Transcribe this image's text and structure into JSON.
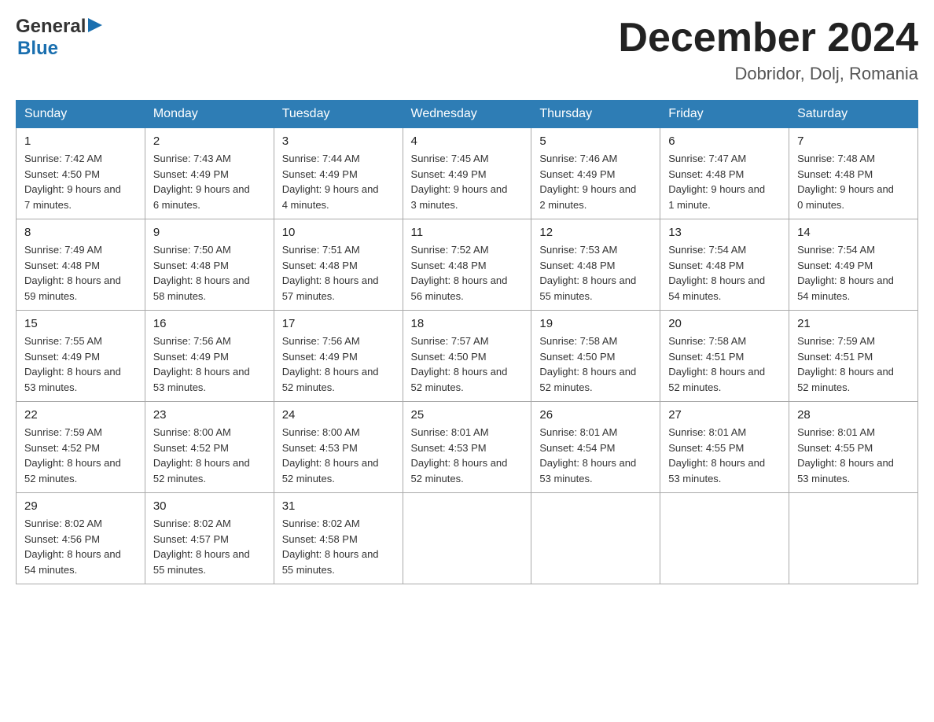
{
  "header": {
    "logo_general": "General",
    "logo_blue": "Blue",
    "month_title": "December 2024",
    "location": "Dobridor, Dolj, Romania"
  },
  "days_of_week": [
    "Sunday",
    "Monday",
    "Tuesday",
    "Wednesday",
    "Thursday",
    "Friday",
    "Saturday"
  ],
  "weeks": [
    [
      {
        "day": "1",
        "sunrise": "7:42 AM",
        "sunset": "4:50 PM",
        "daylight": "9 hours and 7 minutes."
      },
      {
        "day": "2",
        "sunrise": "7:43 AM",
        "sunset": "4:49 PM",
        "daylight": "9 hours and 6 minutes."
      },
      {
        "day": "3",
        "sunrise": "7:44 AM",
        "sunset": "4:49 PM",
        "daylight": "9 hours and 4 minutes."
      },
      {
        "day": "4",
        "sunrise": "7:45 AM",
        "sunset": "4:49 PM",
        "daylight": "9 hours and 3 minutes."
      },
      {
        "day": "5",
        "sunrise": "7:46 AM",
        "sunset": "4:49 PM",
        "daylight": "9 hours and 2 minutes."
      },
      {
        "day": "6",
        "sunrise": "7:47 AM",
        "sunset": "4:48 PM",
        "daylight": "9 hours and 1 minute."
      },
      {
        "day": "7",
        "sunrise": "7:48 AM",
        "sunset": "4:48 PM",
        "daylight": "9 hours and 0 minutes."
      }
    ],
    [
      {
        "day": "8",
        "sunrise": "7:49 AM",
        "sunset": "4:48 PM",
        "daylight": "8 hours and 59 minutes."
      },
      {
        "day": "9",
        "sunrise": "7:50 AM",
        "sunset": "4:48 PM",
        "daylight": "8 hours and 58 minutes."
      },
      {
        "day": "10",
        "sunrise": "7:51 AM",
        "sunset": "4:48 PM",
        "daylight": "8 hours and 57 minutes."
      },
      {
        "day": "11",
        "sunrise": "7:52 AM",
        "sunset": "4:48 PM",
        "daylight": "8 hours and 56 minutes."
      },
      {
        "day": "12",
        "sunrise": "7:53 AM",
        "sunset": "4:48 PM",
        "daylight": "8 hours and 55 minutes."
      },
      {
        "day": "13",
        "sunrise": "7:54 AM",
        "sunset": "4:48 PM",
        "daylight": "8 hours and 54 minutes."
      },
      {
        "day": "14",
        "sunrise": "7:54 AM",
        "sunset": "4:49 PM",
        "daylight": "8 hours and 54 minutes."
      }
    ],
    [
      {
        "day": "15",
        "sunrise": "7:55 AM",
        "sunset": "4:49 PM",
        "daylight": "8 hours and 53 minutes."
      },
      {
        "day": "16",
        "sunrise": "7:56 AM",
        "sunset": "4:49 PM",
        "daylight": "8 hours and 53 minutes."
      },
      {
        "day": "17",
        "sunrise": "7:56 AM",
        "sunset": "4:49 PM",
        "daylight": "8 hours and 52 minutes."
      },
      {
        "day": "18",
        "sunrise": "7:57 AM",
        "sunset": "4:50 PM",
        "daylight": "8 hours and 52 minutes."
      },
      {
        "day": "19",
        "sunrise": "7:58 AM",
        "sunset": "4:50 PM",
        "daylight": "8 hours and 52 minutes."
      },
      {
        "day": "20",
        "sunrise": "7:58 AM",
        "sunset": "4:51 PM",
        "daylight": "8 hours and 52 minutes."
      },
      {
        "day": "21",
        "sunrise": "7:59 AM",
        "sunset": "4:51 PM",
        "daylight": "8 hours and 52 minutes."
      }
    ],
    [
      {
        "day": "22",
        "sunrise": "7:59 AM",
        "sunset": "4:52 PM",
        "daylight": "8 hours and 52 minutes."
      },
      {
        "day": "23",
        "sunrise": "8:00 AM",
        "sunset": "4:52 PM",
        "daylight": "8 hours and 52 minutes."
      },
      {
        "day": "24",
        "sunrise": "8:00 AM",
        "sunset": "4:53 PM",
        "daylight": "8 hours and 52 minutes."
      },
      {
        "day": "25",
        "sunrise": "8:01 AM",
        "sunset": "4:53 PM",
        "daylight": "8 hours and 52 minutes."
      },
      {
        "day": "26",
        "sunrise": "8:01 AM",
        "sunset": "4:54 PM",
        "daylight": "8 hours and 53 minutes."
      },
      {
        "day": "27",
        "sunrise": "8:01 AM",
        "sunset": "4:55 PM",
        "daylight": "8 hours and 53 minutes."
      },
      {
        "day": "28",
        "sunrise": "8:01 AM",
        "sunset": "4:55 PM",
        "daylight": "8 hours and 53 minutes."
      }
    ],
    [
      {
        "day": "29",
        "sunrise": "8:02 AM",
        "sunset": "4:56 PM",
        "daylight": "8 hours and 54 minutes."
      },
      {
        "day": "30",
        "sunrise": "8:02 AM",
        "sunset": "4:57 PM",
        "daylight": "8 hours and 55 minutes."
      },
      {
        "day": "31",
        "sunrise": "8:02 AM",
        "sunset": "4:58 PM",
        "daylight": "8 hours and 55 minutes."
      },
      null,
      null,
      null,
      null
    ]
  ],
  "labels": {
    "sunrise": "Sunrise:",
    "sunset": "Sunset:",
    "daylight": "Daylight:"
  }
}
